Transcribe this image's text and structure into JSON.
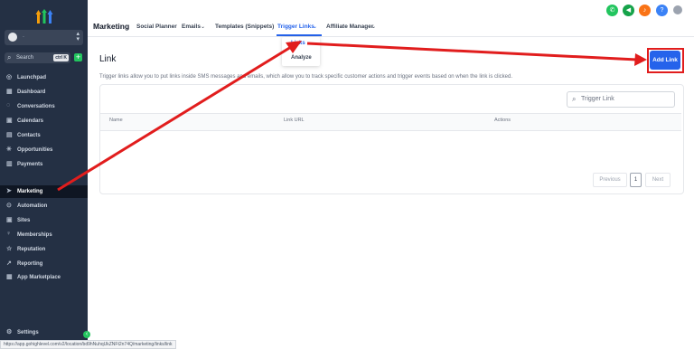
{
  "sidebar": {
    "search_label": "Search",
    "search_kbd": "ctrl K",
    "location_name": "·",
    "items": [
      {
        "label": "Launchpad",
        "icon": "launchpad-icon",
        "glyph": "◎"
      },
      {
        "label": "Dashboard",
        "icon": "dashboard-icon",
        "glyph": "▦"
      },
      {
        "label": "Conversations",
        "icon": "chat-icon",
        "glyph": "◌"
      },
      {
        "label": "Calendars",
        "icon": "calendar-icon",
        "glyph": "▣"
      },
      {
        "label": "Contacts",
        "icon": "contacts-icon",
        "glyph": "▤"
      },
      {
        "label": "Opportunities",
        "icon": "opportunities-icon",
        "glyph": "✳"
      },
      {
        "label": "Payments",
        "icon": "payments-icon",
        "glyph": "▥"
      },
      {
        "label": "Marketing",
        "icon": "send-icon",
        "glyph": "➤"
      },
      {
        "label": "Automation",
        "icon": "automation-icon",
        "glyph": "⊙"
      },
      {
        "label": "Sites",
        "icon": "sites-icon",
        "glyph": "▣"
      },
      {
        "label": "Memberships",
        "icon": "memberships-icon",
        "glyph": "♀"
      },
      {
        "label": "Reputation",
        "icon": "star-icon",
        "glyph": "☆"
      },
      {
        "label": "Reporting",
        "icon": "reporting-icon",
        "glyph": "↗"
      },
      {
        "label": "App Marketplace",
        "icon": "marketplace-icon",
        "glyph": "▦"
      },
      {
        "label": "Settings",
        "icon": "gear-icon",
        "glyph": "⚙"
      }
    ]
  },
  "header": {
    "title": "Marketing",
    "tabs": [
      {
        "label": "Social Planner"
      },
      {
        "label": "Emails"
      },
      {
        "label": "Templates (Snippets)"
      },
      {
        "label": "Trigger Links"
      },
      {
        "label": "Affiliate Manager"
      }
    ],
    "active_tab": "Trigger Links",
    "dropdown": {
      "items": [
        "Links",
        "Analyze"
      ]
    }
  },
  "page": {
    "title": "Link",
    "description": "Trigger links allow you to put links inside SMS messages and emails, which allow you to track specific customer actions and trigger events based on when the link is clicked.",
    "add_button": "Add Link",
    "search_placeholder": "Trigger Link",
    "table": {
      "columns": [
        "Name",
        "Link URL",
        "Actions"
      ]
    },
    "pagination": {
      "previous": "Previous",
      "current": "1",
      "next": "Next"
    }
  },
  "status_url": "https://app.gohighlevel.com/v2/location/bd9hNuhqUkZNFt2n74Q/marketing/links/link",
  "colors": {
    "sidebar": "#243044",
    "accent": "#2563eb",
    "annotation": "#e11d1d"
  }
}
